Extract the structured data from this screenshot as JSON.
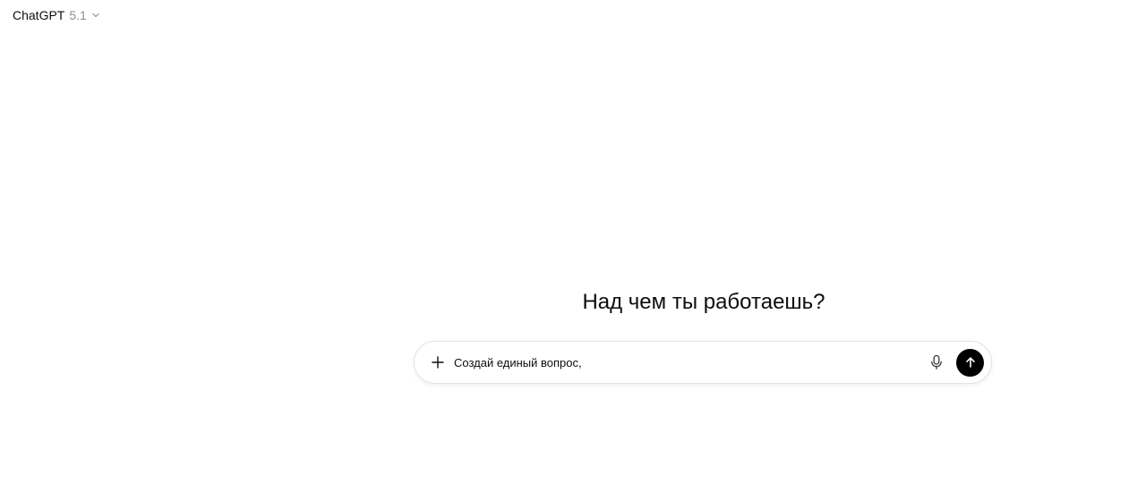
{
  "header": {
    "model_name": "ChatGPT",
    "model_version": "5.1",
    "dropdown_icon": "chevron-down-icon"
  },
  "main": {
    "heading": "Над чем ты работаешь?"
  },
  "composer": {
    "input_value": "Создай единый вопрос,",
    "add_icon": "plus-icon",
    "voice_icon": "microphone-icon",
    "send_icon": "arrow-up-icon"
  },
  "colors": {
    "text": "#0d0d0d",
    "muted": "#8f8f8f",
    "send_button": "#000000",
    "border": "#e3e3e3"
  }
}
